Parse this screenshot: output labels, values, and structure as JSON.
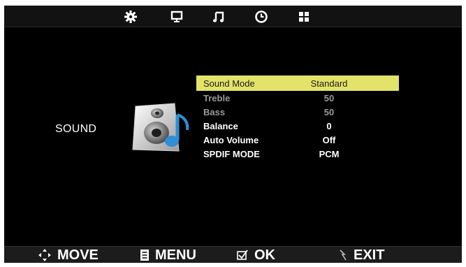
{
  "tabs": [
    {
      "icon": "gear-icon"
    },
    {
      "icon": "monitor-icon"
    },
    {
      "icon": "music-note-icon"
    },
    {
      "icon": "clock-icon"
    },
    {
      "icon": "grid-icon"
    }
  ],
  "section_title": "SOUND",
  "menu": [
    {
      "label": "Sound Mode",
      "value": "Standard",
      "state": "selected"
    },
    {
      "label": "Treble",
      "value": "50",
      "state": "dim"
    },
    {
      "label": "Bass",
      "value": "50",
      "state": "dim"
    },
    {
      "label": "Balance",
      "value": "0",
      "state": "normal"
    },
    {
      "label": "Auto Volume",
      "value": "Off",
      "state": "normal"
    },
    {
      "label": "SPDIF MODE",
      "value": "PCM",
      "state": "normal"
    }
  ],
  "footer": {
    "move": "MOVE",
    "menu": "MENU",
    "ok": "OK",
    "exit": "EXIT"
  },
  "colors": {
    "highlight": "#e3e36a",
    "dim_text": "#9a9a9a",
    "accent_blue": "#2f8fd6"
  }
}
